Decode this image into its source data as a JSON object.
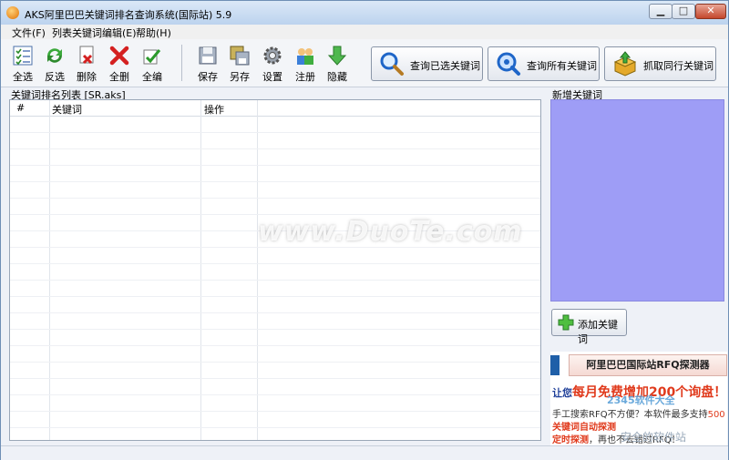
{
  "window": {
    "title": "AKS阿里巴巴关键词排名查询系统(国际站)  5.9",
    "controls": {
      "minimize": "▁",
      "maximize": "□",
      "close": "✕"
    }
  },
  "menu": [
    "文件(F)",
    "列表关键词编辑(E)",
    "帮助(H)"
  ],
  "toolbar": {
    "select_all": "全选",
    "invert": "反选",
    "delete": "删除",
    "delete_all": "全删",
    "edit_all": "全编",
    "save": "保存",
    "save_as": "另存",
    "settings": "设置",
    "register": "注册",
    "hide": "隐藏"
  },
  "actions": {
    "query_selected": "查询已选关键词",
    "query_all": "查询所有关键词",
    "fetch_peers": "抓取同行关键词"
  },
  "list": {
    "caption": "关键词排名列表 [SR.aks]",
    "columns": [
      "#",
      "关键词",
      "操作"
    ]
  },
  "watermark": "www.DuoTe.com",
  "right_panel": {
    "caption": "新增关键词",
    "add_button": "添加关键词"
  },
  "ad": {
    "title": "阿里巴巴国际站RFQ探测器",
    "line1_prefix": "让您",
    "line1_highlight": "每月免费增加200个询盘！！",
    "line2": "手工搜索RFQ不方便？本软件最多支持",
    "line2_red": "500",
    "line3": "关键词自动探测",
    "line4_red": "定时探测",
    "line4": "，再也不去错过RFQ！"
  },
  "overlay_watermarks": {
    "w2345": "2345软件大全",
    "wsite": "安全的软件站"
  },
  "colors": {
    "accent_panel": "#9e9df6",
    "ad_red": "#e03a1c",
    "ad_blue": "#1f3f99"
  }
}
